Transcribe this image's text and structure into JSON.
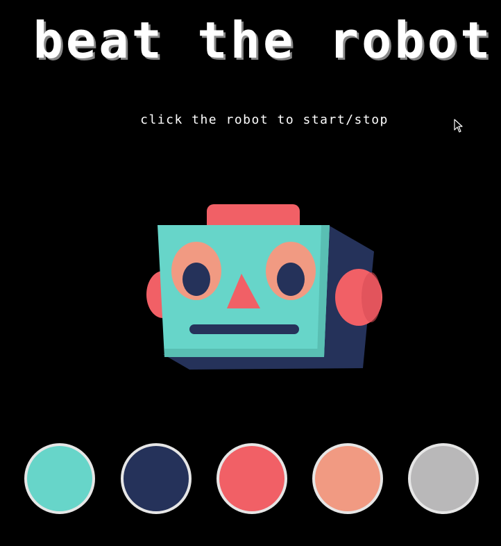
{
  "title": "beat the robot",
  "instruction": "click the robot to start/stop",
  "robot": {
    "icon": "robot-head-icon",
    "colors": {
      "face": "#67d5c9",
      "face_shadow": "#59bfb3",
      "side": "#25325a",
      "antenna": "#f16066",
      "ears": "#f16066",
      "eye_ring": "#f19a82",
      "pupil": "#25325a",
      "nose": "#f16066",
      "mouth": "#25325a"
    }
  },
  "swatches": [
    {
      "name": "teal",
      "color": "#67d5c9"
    },
    {
      "name": "navy",
      "color": "#25325a"
    },
    {
      "name": "coral",
      "color": "#f16066"
    },
    {
      "name": "salmon",
      "color": "#f19a82"
    },
    {
      "name": "gray",
      "color": "#b9b8b9"
    }
  ]
}
